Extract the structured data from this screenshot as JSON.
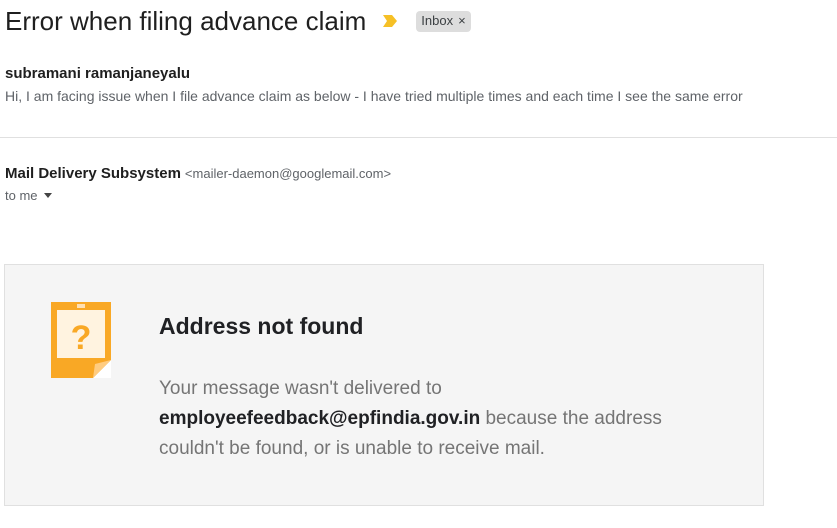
{
  "subject": "Error when filing advance claim",
  "label": {
    "name": "Inbox",
    "remove_glyph": "×"
  },
  "icons": {
    "importance": "importance-marker-icon",
    "expand": "chevron-down-icon",
    "ndr": "question-note-icon"
  },
  "colors": {
    "importance_marker": "#f6c026",
    "ndr_icon_orange": "#f9a825",
    "ndr_icon_light": "#fff3e0"
  },
  "collapsed_message": {
    "sender": "subramani ramanjaneyalu",
    "snippet": "Hi, I am facing issue when I file advance claim as below - I have tried multiple times and each time I see the same error"
  },
  "open_message": {
    "from_name": "Mail Delivery Subsystem",
    "from_email": "<mailer-daemon@googlemail.com>",
    "to_label": "to me"
  },
  "bounce": {
    "title": "Address not found",
    "body_prefix": "Your message wasn't delivered to",
    "address": "employeefeedback@epfindia.gov.in",
    "body_suffix": "because the address couldn't be found, or is unable to receive mail."
  }
}
